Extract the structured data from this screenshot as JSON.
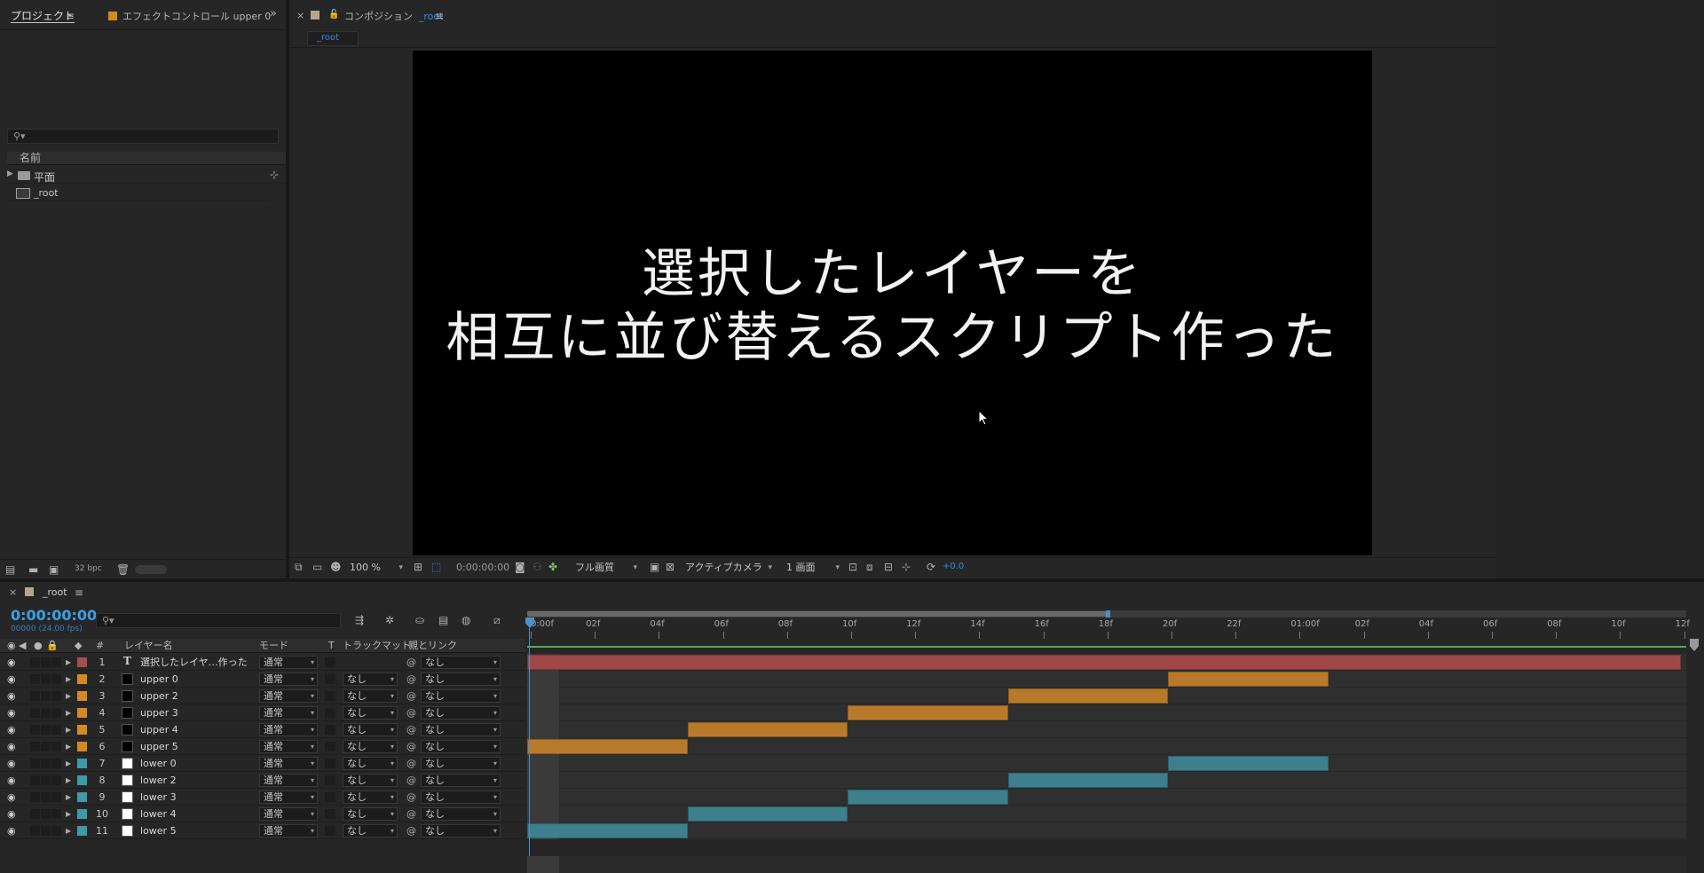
{
  "project_panel": {
    "tab_project": "プロジェクト",
    "tab_effects": "エフェクトコントロール upper 0",
    "column_name": "名前",
    "items": [
      {
        "name": "平面",
        "type": "folder"
      },
      {
        "name": "_root",
        "type": "composition"
      }
    ],
    "bpc": "32 bpc"
  },
  "comp_panel": {
    "tab_prefix": "コンポジション",
    "tab_comp_name": "_root",
    "breadcrumb": "_root",
    "canvas_text_line1": "選択したレイヤーを",
    "canvas_text_line2": "相互に並び替えるスクリプト作った",
    "zoom": "100 %",
    "timecode": "0:00:00:00",
    "resolution": "フル画質",
    "camera": "アクティブカメラ",
    "views": "1 画面",
    "exposure": "+0.0"
  },
  "timeline": {
    "tab_name": "_root",
    "current_time": "0:00:00:00",
    "frame_info": "00000 (24.00 fps)",
    "columns": {
      "num": "#",
      "layer_name": "レイヤー名",
      "mode": "モード",
      "t": "T",
      "track_matte": "トラックマット",
      "parent": "親とリンク"
    },
    "ruler_ticks": [
      "0:00f",
      "02f",
      "04f",
      "06f",
      "08f",
      "10f",
      "12f",
      "14f",
      "16f",
      "18f",
      "20f",
      "22f",
      "01:00f",
      "02f",
      "04f",
      "06f",
      "08f",
      "10f",
      "12f"
    ],
    "layers": [
      {
        "num": "1",
        "name": "選択したレイヤ…作った",
        "mode": "通常",
        "matte": "",
        "parent": "なし",
        "label_color": "#a34f4f",
        "thumb": "T",
        "bar_start": 0,
        "bar_end": 36,
        "bar_color": "#a04848"
      },
      {
        "num": "2",
        "name": "upper 0",
        "mode": "通常",
        "matte": "なし",
        "parent": "なし",
        "label_color": "#d48a22",
        "thumb": "black",
        "bar_start": 20,
        "bar_end": 25,
        "bar_color": "#b87a2a"
      },
      {
        "num": "3",
        "name": "upper 2",
        "mode": "通常",
        "matte": "なし",
        "parent": "なし",
        "label_color": "#d48a22",
        "thumb": "black",
        "bar_start": 15,
        "bar_end": 20,
        "bar_color": "#b87a2a"
      },
      {
        "num": "4",
        "name": "upper 3",
        "mode": "通常",
        "matte": "なし",
        "parent": "なし",
        "label_color": "#d48a22",
        "thumb": "black",
        "bar_start": 10,
        "bar_end": 15,
        "bar_color": "#b87a2a"
      },
      {
        "num": "5",
        "name": "upper 4",
        "mode": "通常",
        "matte": "なし",
        "parent": "なし",
        "label_color": "#d48a22",
        "thumb": "black",
        "bar_start": 5,
        "bar_end": 10,
        "bar_color": "#b87a2a"
      },
      {
        "num": "6",
        "name": "upper 5",
        "mode": "通常",
        "matte": "なし",
        "parent": "なし",
        "label_color": "#d48a22",
        "thumb": "black",
        "bar_start": 0,
        "bar_end": 5,
        "bar_color": "#b87a2a"
      },
      {
        "num": "7",
        "name": "lower 0",
        "mode": "通常",
        "matte": "なし",
        "parent": "なし",
        "label_color": "#3f9aa8",
        "thumb": "white",
        "bar_start": 20,
        "bar_end": 25,
        "bar_color": "#3d7f8c"
      },
      {
        "num": "8",
        "name": "lower 2",
        "mode": "通常",
        "matte": "なし",
        "parent": "なし",
        "label_color": "#3f9aa8",
        "thumb": "white",
        "bar_start": 15,
        "bar_end": 20,
        "bar_color": "#3d7f8c"
      },
      {
        "num": "9",
        "name": "lower 3",
        "mode": "通常",
        "matte": "なし",
        "parent": "なし",
        "label_color": "#3f9aa8",
        "thumb": "white",
        "bar_start": 10,
        "bar_end": 15,
        "bar_color": "#3d7f8c"
      },
      {
        "num": "10",
        "name": "lower 4",
        "mode": "通常",
        "matte": "なし",
        "parent": "なし",
        "label_color": "#3f9aa8",
        "thumb": "white",
        "bar_start": 5,
        "bar_end": 10,
        "bar_color": "#3d7f8c"
      },
      {
        "num": "11",
        "name": "lower 5",
        "mode": "通常",
        "matte": "なし",
        "parent": "なし",
        "label_color": "#3f9aa8",
        "thumb": "white",
        "bar_start": 0,
        "bar_end": 5,
        "bar_color": "#3d7f8c"
      }
    ]
  },
  "colors": {
    "accent_blue": "#2d8ceb",
    "timecode_blue": "#3aa0e8",
    "workarea_green": "#4caf50"
  }
}
